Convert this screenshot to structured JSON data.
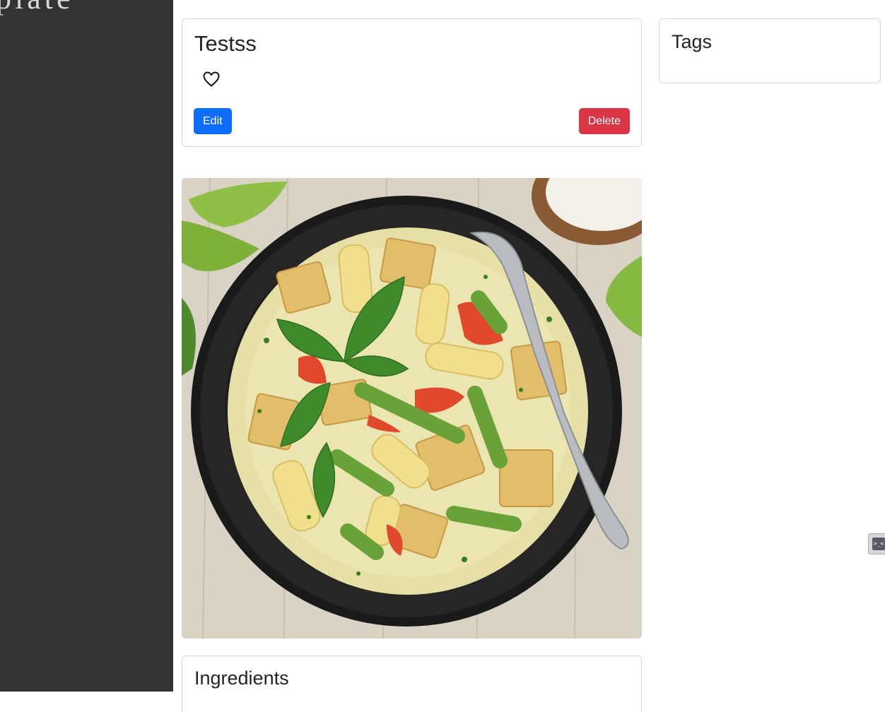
{
  "sidebar": {
    "brand": "plate"
  },
  "recipe": {
    "title": "Testss",
    "favorite_icon": "heart-outline-icon",
    "edit_label": "Edit",
    "delete_label": "Delete"
  },
  "tags": {
    "title": "Tags"
  },
  "photo": {
    "alt": "Bowl of green curry with tofu, baby corn, asparagus, red bell pepper and basil"
  },
  "ingredients": {
    "title": "Ingredients"
  },
  "colors": {
    "sidebar_bg": "#333333",
    "primary": "#0d6efd",
    "danger": "#dc3545"
  },
  "dev_widget": {
    "icon": "developer-tools-icon",
    "glyph": ">_<"
  }
}
